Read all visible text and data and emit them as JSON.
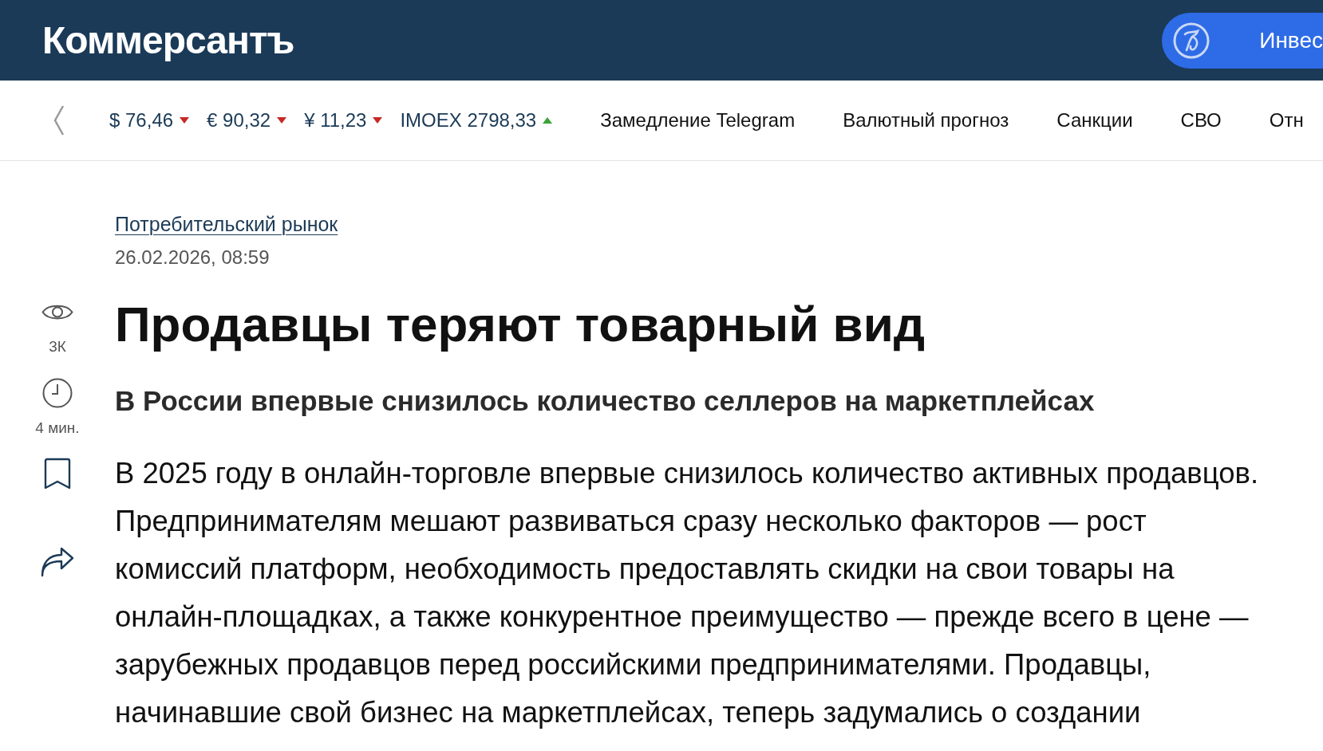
{
  "header": {
    "logo": "Коммерсантъ",
    "promo_button": {
      "label": "Инвес"
    }
  },
  "ticker": {
    "rates": [
      {
        "label": "$ 76,46",
        "rising": false
      },
      {
        "label": "€ 90,32",
        "rising": false
      },
      {
        "label": "¥ 11,23",
        "rising": false
      },
      {
        "label": "IMOEX 2798,33",
        "rising": true
      }
    ],
    "links": [
      "Замедление Telegram",
      "Валютный прогноз",
      "Санкции",
      "СВО",
      "Отн"
    ]
  },
  "article_tools": {
    "views": "3К",
    "read_time": "4 мин."
  },
  "article": {
    "rubric": "Потребительский рынок",
    "date": "26.02.2026, 08:59",
    "title": "Продавцы теряют товарный вид",
    "subtitle": "В России впервые снизилось количество селлеров на маркетплейсах",
    "lead_lines": [
      "В 2025 году в онлайн-торговле впервые снизилось количество активных продавцов.",
      "Предпринимателям мешают развиваться сразу несколько факторов — рост",
      "комиссий платформ, необходимость предоставлять скидки на свои товары на",
      "онлайн-площадках, а также конкурентное преимущество — прежде всего в цене —",
      "зарубежных продавцов перед российскими предпринимателями. Продавцы,",
      "начинавшие свой бизнес на маркетплейсах, теперь задумались о создании"
    ]
  }
}
